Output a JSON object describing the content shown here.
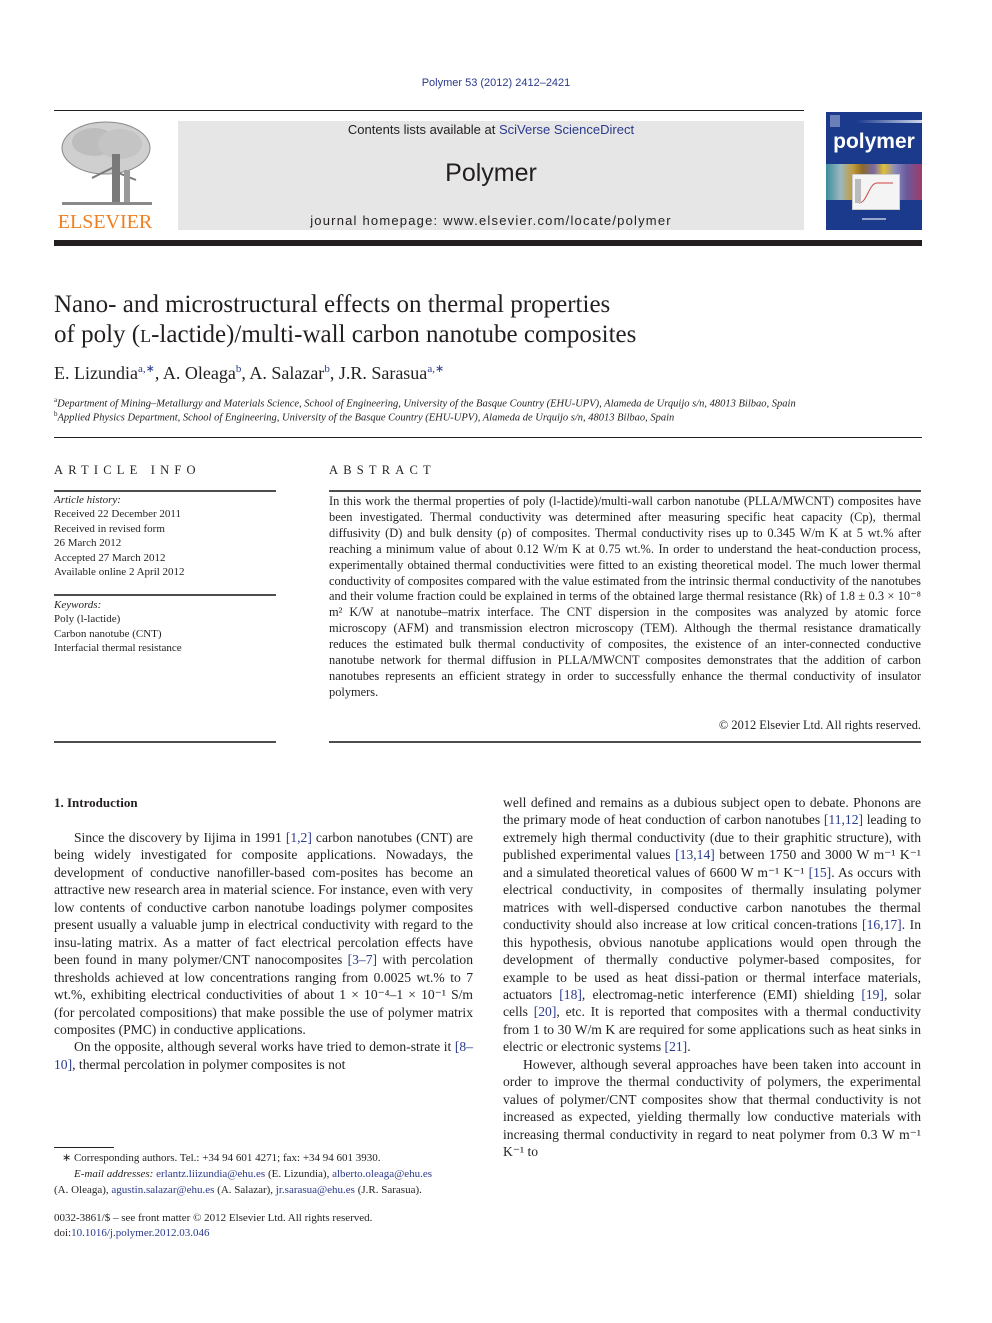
{
  "header": {
    "journal_ref": "Polymer 53 (2012) 2412–2421",
    "contents_prefix": "Contents lists available at ",
    "contents_link": "SciVerse ScienceDirect",
    "journal_title": "Polymer",
    "homepage": "journal homepage: www.elsevier.com/locate/polymer",
    "publisher_logo_text": "ELSEVIER",
    "cover_title": "polymer",
    "colors": {
      "link": "#2a3a8c",
      "elsevier_orange": "#f07f1f",
      "cover_blue": "#1b3a8c",
      "masthead_gray": "#e6e6e6"
    }
  },
  "article": {
    "title_line1": "Nano- and microstructural effects on thermal properties",
    "title_line2_pre": "of poly (",
    "title_line2_sc": "l",
    "title_line2_post": "-lactide)/multi-wall carbon nanotube composites",
    "authors": [
      {
        "name": "E. Lizundia",
        "sup": "a,∗"
      },
      {
        "name": "A. Oleaga",
        "sup": "b"
      },
      {
        "name": "A. Salazar",
        "sup": "b"
      },
      {
        "name": "J.R. Sarasua",
        "sup": "a,∗"
      }
    ],
    "affiliations": [
      {
        "label": "a",
        "text": "Department of Mining–Metallurgy and Materials Science, School of Engineering, University of the Basque Country (EHU-UPV), Alameda de Urquijo s/n, 48013 Bilbao, Spain"
      },
      {
        "label": "b",
        "text": "Applied Physics Department, School of Engineering, University of the Basque Country (EHU-UPV), Alameda de Urquijo s/n, 48013 Bilbao, Spain"
      }
    ]
  },
  "article_info": {
    "heading": "ARTICLE INFO",
    "history_label": "Article history:",
    "history": [
      "Received 22 December 2011",
      "Received in revised form",
      "26 March 2012",
      "Accepted 27 March 2012",
      "Available online 2 April 2012"
    ],
    "keywords_label": "Keywords:",
    "keywords": [
      "Poly (l-lactide)",
      "Carbon nanotube (CNT)",
      "Interfacial thermal resistance"
    ]
  },
  "abstract": {
    "heading": "ABSTRACT",
    "text": "In this work the thermal properties of poly (l-lactide)/multi-wall carbon nanotube (PLLA/MWCNT) composites have been investigated. Thermal conductivity was determined after measuring specific heat capacity (Cp), thermal diffusivity (D) and bulk density (ρ) of composites. Thermal conductivity rises up to 0.345 W/m K at 5 wt.% after reaching a minimum value of about 0.12 W/m K at 0.75 wt.%. In order to understand the heat-conduction process, experimentally obtained thermal conductivities were fitted to an existing theoretical model. The much lower thermal conductivity of composites compared with the value estimated from the intrinsic thermal conductivity of the nanotubes and their volume fraction could be explained in terms of the obtained large thermal resistance (Rk) of 1.8 ± 0.3 × 10⁻⁸ m² K/W at nanotube–matrix interface. The CNT dispersion in the composites was analyzed by atomic force microscopy (AFM) and transmission electron microscopy (TEM). Although the thermal resistance dramatically reduces the estimated bulk thermal conductivity of composites, the existence of an inter-connected conductive nanotube network for thermal diffusion in PLLA/MWCNT composites demonstrates that the addition of carbon nanotubes represents an efficient strategy in order to successfully enhance the thermal conductivity of insulator polymers.",
    "copyright": "© 2012 Elsevier Ltd. All rights reserved."
  },
  "introduction": {
    "heading": "1.  Introduction",
    "p1": [
      "Since the discovery by Iijima in 1991 ",
      "[1,2]",
      " carbon nanotubes (CNT) are being widely investigated for composite applications. Nowadays, the development of conductive nanofiller-based com-posites has become an attractive new research area in material science. For instance, even with very low contents of conductive carbon nanotube loadings polymer composites present usually a valuable jump in electrical conductivity with regard to the insu-lating matrix. As a matter of fact electrical percolation effects have been found in many polymer/CNT nanocomposites ",
      "[3–7]",
      " with percolation thresholds achieved at low concentrations ranging from 0.0025 wt.% to 7 wt.%, exhibiting electrical conductivities of about 1 × 10⁻⁴–1 × 10⁻¹ S/m (for percolated compositions) that make possible the use of polymer matrix composites (PMC) in conductive applications."
    ],
    "p2": [
      "On the opposite, although several works have tried to demon-strate it ",
      "[8–10]",
      ", thermal percolation in polymer composites is not well defined and remains as a dubious subject open to debate. Phonons are the primary mode of heat conduction of carbon nanotubes ",
      "[11,12]",
      " leading to extremely high thermal conductivity (due to their graphitic structure), with published experimental values ",
      "[13,14]",
      " between 1750 and 3000 W m⁻¹ K⁻¹ and a simulated theoretical values of 6600 W m⁻¹ K⁻¹ ",
      "[15]",
      ". As occurs with electrical conductivity, in composites of thermally insulating polymer matrices with well-dispersed conductive carbon nanotubes the thermal conductivity should also increase at low critical concen-trations ",
      "[16,17]",
      ". In this hypothesis, obvious nanotube applications would open through the development of thermally conductive polymer-based composites, for example to be used as heat dissi-pation or thermal interface materials, actuators ",
      "[18]",
      ", electromag-netic interference (EMI) shielding ",
      "[19]",
      ", solar cells ",
      "[20]",
      ", etc. It is reported that composites with a thermal conductivity from 1 to 30 W/m K are required for some applications such as heat sinks in electric or electronic systems ",
      "[21]",
      "."
    ],
    "p3": "However, although several approaches have been taken into account in order to improve the thermal conductivity of polymers, the experimental values of polymer/CNT composites show that thermal conductivity is not increased as expected, yielding thermally low conductive materials with increasing thermal conductivity in regard to neat polymer from 0.3 W m⁻¹ K⁻¹ to"
  },
  "footnote": {
    "corresponding": "∗ Corresponding authors. Tel.: +34 94 601 4271; fax: +34 94 601 3930.",
    "email_label": "E-mail addresses:",
    "emails": [
      {
        "address": "erlantz.liizundia@ehu.es",
        "who": "(E. Lizundia)"
      },
      {
        "address": "alberto.oleaga@ehu.es",
        "who": "(A. Oleaga)"
      },
      {
        "address": "agustin.salazar@ehu.es",
        "who": "(A. Salazar)"
      },
      {
        "address": "jr.sarasua@ehu.es",
        "who": "(J.R. Sarasua)."
      }
    ]
  },
  "front_matter": {
    "issn_line": "0032-3861/$ – see front matter © 2012 Elsevier Ltd. All rights reserved.",
    "doi_prefix": "doi:",
    "doi": "10.1016/j.polymer.2012.03.046"
  }
}
